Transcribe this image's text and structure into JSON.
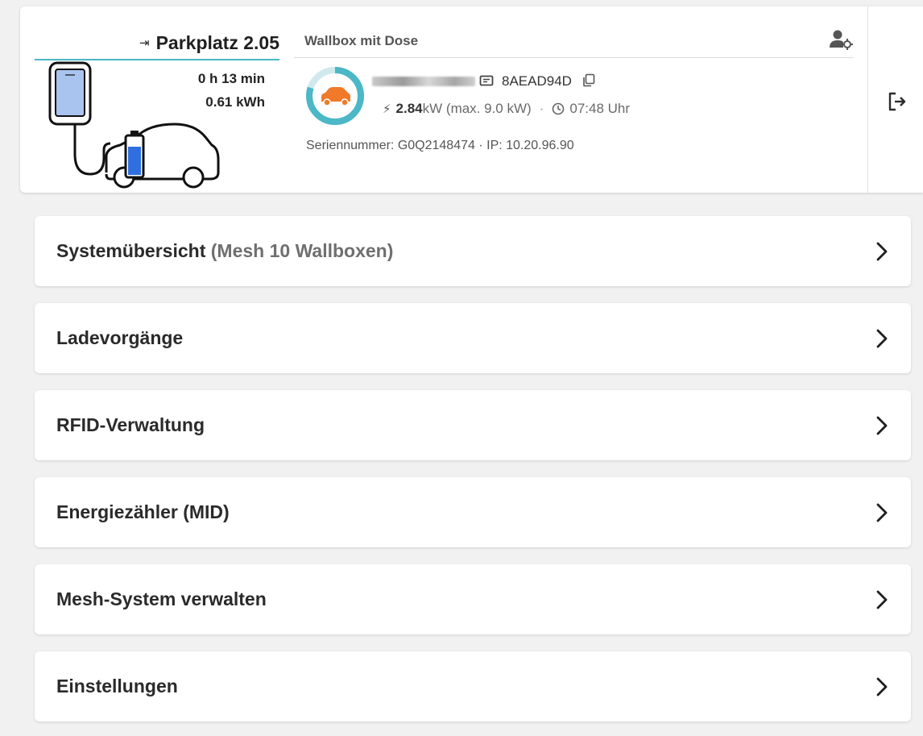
{
  "header": {
    "station_name": "Parkplatz 2.05",
    "duration": "0 h 13 min",
    "energy": "0.61 kWh",
    "model": "Wallbox mit Dose",
    "rfid_id": "8AEAD94D",
    "power_value": "2.84",
    "power_unit": " kW (max. 9.0 kW)",
    "separator": "·",
    "time": "07:48 Uhr",
    "serial_line": "Seriennummer: G0Q2148474 · IP: 10.20.96.90",
    "charge_level": 0.8,
    "colors": {
      "accent": "#4bb7c7",
      "car": "#f07a2a",
      "battery": "#2f6fe0",
      "wallbox_screen": "#a8c4ef"
    },
    "icons": [
      "login-icon",
      "user-settings-icon",
      "card-icon",
      "copy-icon",
      "bolt-icon",
      "clock-icon",
      "logout-icon"
    ]
  },
  "menu": [
    {
      "label": "Systemübersicht",
      "suffix": " (Mesh 10 Wallboxen)"
    },
    {
      "label": "Ladevorgänge",
      "suffix": ""
    },
    {
      "label": "RFID-Verwaltung",
      "suffix": ""
    },
    {
      "label": "Energiezähler (MID)",
      "suffix": ""
    },
    {
      "label": "Mesh-System verwalten",
      "suffix": ""
    },
    {
      "label": "Einstellungen",
      "suffix": ""
    }
  ]
}
